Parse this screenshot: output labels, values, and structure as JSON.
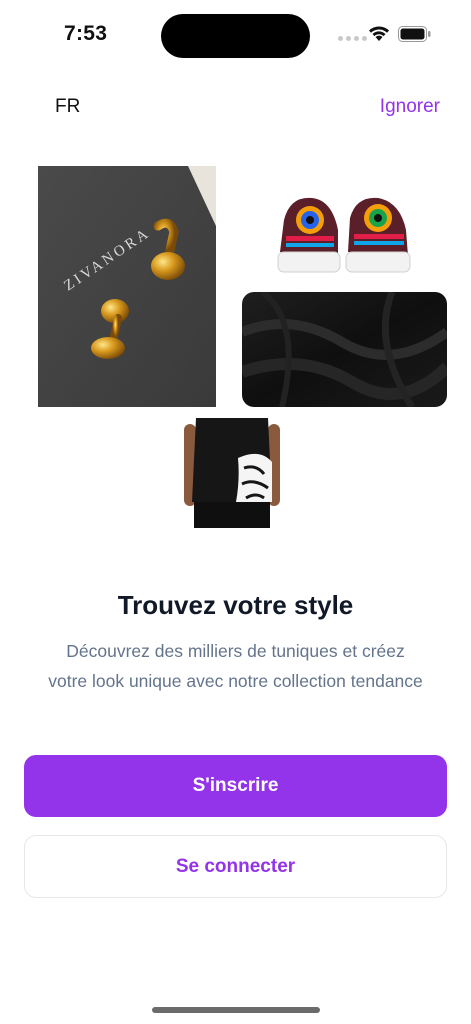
{
  "status_bar": {
    "time": "7:53"
  },
  "header": {
    "language": "FR",
    "skip_label": "Ignorer"
  },
  "collage": {
    "cufflinks_brand": "ZIVANORA"
  },
  "onboarding": {
    "title": "Trouvez votre style",
    "subtitle_line1": "Découvrez des milliers de tuniques et créez",
    "subtitle_line2": "votre look unique avec notre collection tendance"
  },
  "actions": {
    "signup_label": "S'inscrire",
    "login_label": "Se connecter"
  },
  "colors": {
    "accent": "#9333ea",
    "title": "#111827",
    "subtitle": "#64748b"
  }
}
